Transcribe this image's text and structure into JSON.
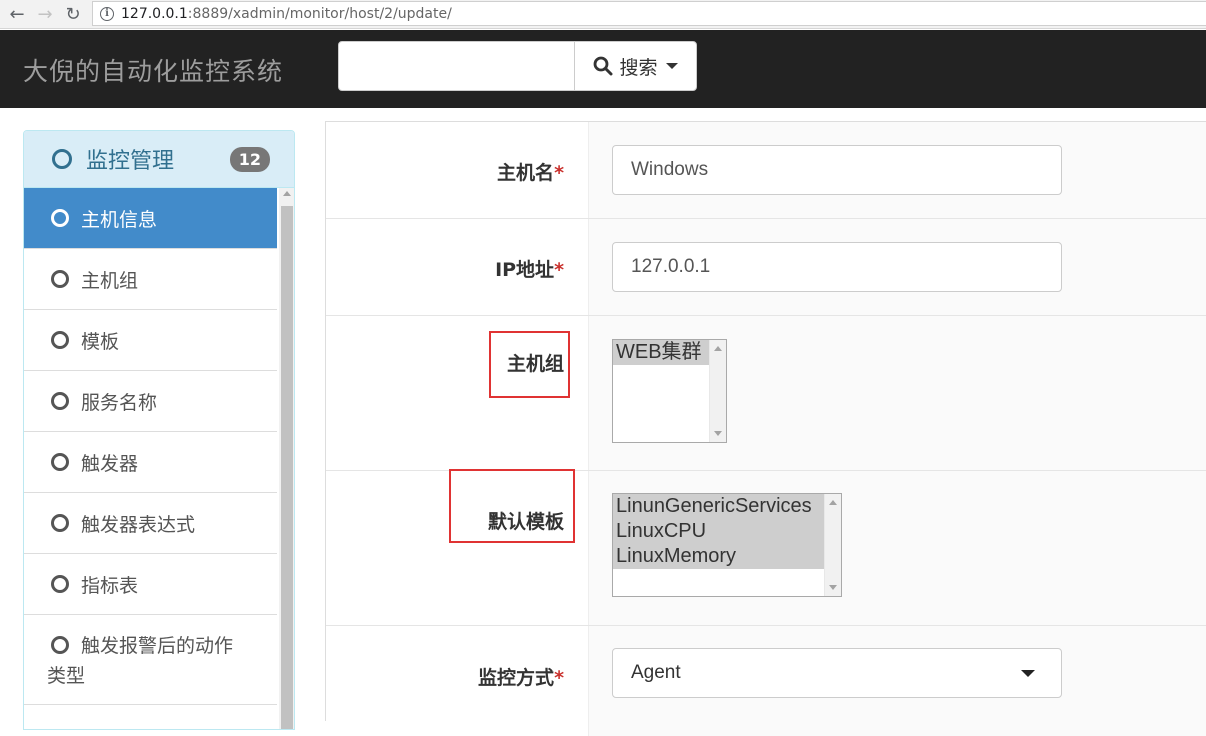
{
  "browser": {
    "url_host": "127.0.0.1",
    "url_rest": ":8889/xadmin/monitor/host/2/update/"
  },
  "navbar": {
    "brand": "大倪的自动化监控系统",
    "search_value": "",
    "search_button": "搜索"
  },
  "sidebar": {
    "heading": "监控管理",
    "badge": "12",
    "items": [
      {
        "label": "主机信息"
      },
      {
        "label": "主机组"
      },
      {
        "label": "模板"
      },
      {
        "label": "服务名称"
      },
      {
        "label": "触发器"
      },
      {
        "label": "触发器表达式"
      },
      {
        "label": "指标表"
      },
      {
        "label_line1": "触发报警后的动作",
        "label_line2": "类型"
      }
    ]
  },
  "form": {
    "hostname": {
      "label": "主机名",
      "required_mark": "*",
      "value": "Windows"
    },
    "ip": {
      "label": "IP地址",
      "required_mark": "*",
      "value": "127.0.0.1"
    },
    "host_group": {
      "label": "主机组",
      "options": [
        "WEB集群"
      ]
    },
    "default_template": {
      "label": "默认模板",
      "options": [
        "LinunGenericServices",
        "LinuxCPU",
        "LinuxMemory"
      ]
    },
    "monitor_method": {
      "label": "监控方式",
      "required_mark": "*",
      "value": "Agent"
    }
  },
  "colors": {
    "navbar_bg": "#222222",
    "active_item": "#428bca",
    "panel_heading_bg": "#d9edf7",
    "annotation_red": "#e03333"
  }
}
